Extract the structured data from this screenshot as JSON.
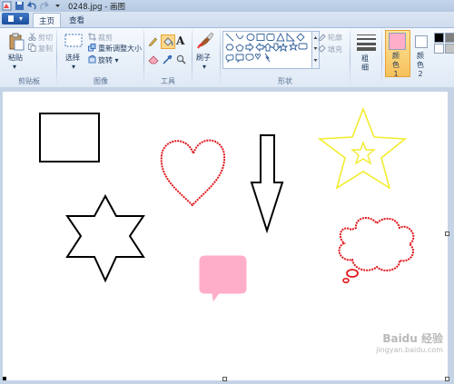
{
  "window": {
    "title": "0248.jpg - 画图"
  },
  "tabs": {
    "file": "▾",
    "home": "主页",
    "view": "查看"
  },
  "clipboard": {
    "paste": "粘贴",
    "cut": "剪切",
    "copy": "复制",
    "group_label": "剪贴板"
  },
  "image": {
    "select": "选择",
    "crop": "裁剪",
    "resize": "重新调整大小",
    "rotate": "旋转",
    "group_label": "图像"
  },
  "tools": {
    "group_label": "工具"
  },
  "brushes": {
    "label": "刷子"
  },
  "shapes": {
    "outline": "轮廓",
    "fill": "填充",
    "group_label": "形状"
  },
  "size": {
    "label": "粗",
    "label2": "细"
  },
  "colors": {
    "color1_label": "颜色 1",
    "color2_label": "颜色 2",
    "color1": "#ffaec9",
    "color2": "#ffffff",
    "palette": [
      "#000000",
      "#7f7f7f",
      "#ffffff",
      "#c3c3c3"
    ]
  },
  "canvas_shapes": [
    {
      "name": "rectangle",
      "color": "#000000"
    },
    {
      "name": "heart",
      "color": "#e0161c"
    },
    {
      "name": "arrow-down",
      "color": "#000000"
    },
    {
      "name": "star-5",
      "color": "#f2ec2e"
    },
    {
      "name": "star-6",
      "color": "#000000"
    },
    {
      "name": "speech-bubble",
      "color": "#ffaec9"
    },
    {
      "name": "thought-cloud",
      "color": "#e0161c"
    }
  ],
  "watermark": {
    "line1": "Baidu 经验",
    "line2": "jingyan.baidu.com"
  }
}
